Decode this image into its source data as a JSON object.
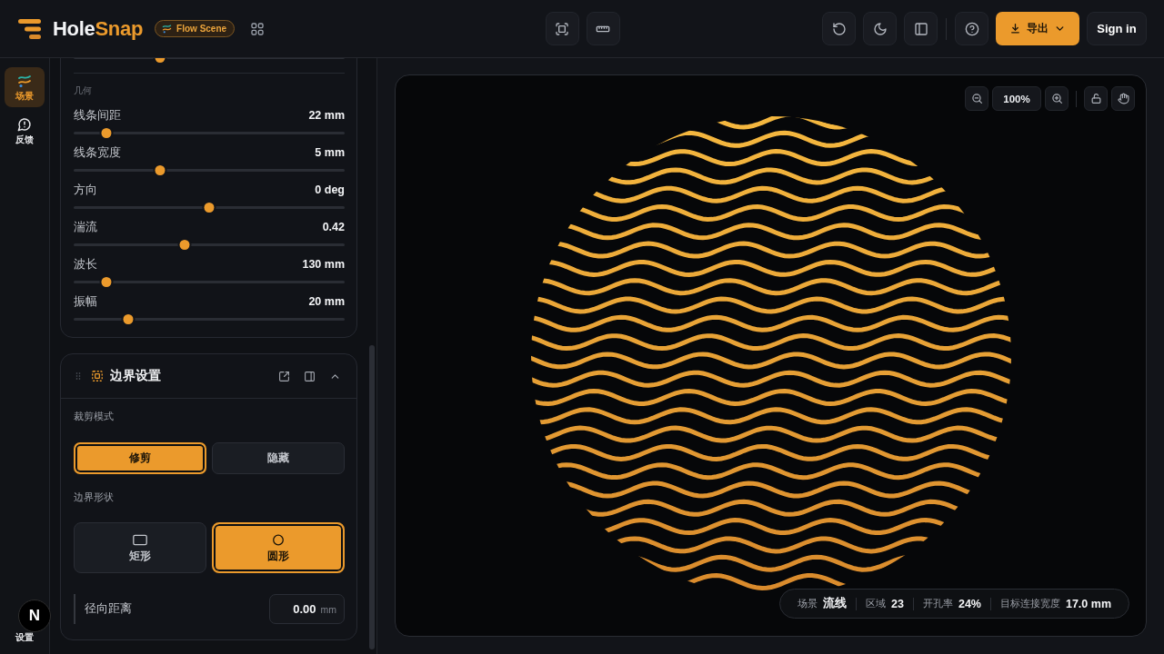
{
  "header": {
    "logo": {
      "main": "Hole",
      "accent": "Snap"
    },
    "badge": "Flow Scene",
    "export_button": "导出",
    "sign_in_button": "Sign in"
  },
  "rail": {
    "items": [
      {
        "label": "场景",
        "kind": "scene",
        "selected": true
      },
      {
        "label": "反馈",
        "kind": "feedback",
        "selected": false
      }
    ],
    "bottom_label": "设置"
  },
  "dev_badge": "N",
  "panel": {
    "top_slider": {
      "level": 0.32
    },
    "geometry": {
      "heading": "几何",
      "sliders": [
        {
          "label": "线条间距",
          "value": "22 mm",
          "level": 0.12
        },
        {
          "label": "线条宽度",
          "value": "5 mm",
          "level": 0.32
        },
        {
          "label": "方向",
          "value": "0 deg",
          "level": 0.5
        },
        {
          "label": "湍流",
          "value": "0.42",
          "level": 0.41
        },
        {
          "label": "波长",
          "value": "130 mm",
          "level": 0.12
        },
        {
          "label": "振幅",
          "value": "20 mm",
          "level": 0.2
        }
      ]
    },
    "boundary": {
      "title": "边界设置",
      "expanded": true,
      "clip_mode": {
        "label": "裁剪模式",
        "options": [
          {
            "label": "修剪",
            "selected": true
          },
          {
            "label": "隐藏",
            "selected": false
          }
        ]
      },
      "shape": {
        "label": "边界形状",
        "options": [
          {
            "label": "矩形",
            "kind": "rectangle",
            "selected": false
          },
          {
            "label": "圆形",
            "kind": "circle",
            "selected": true
          }
        ]
      },
      "radial_distance": {
        "label": "径向距离",
        "value": "0.00",
        "unit": "mm"
      }
    }
  },
  "canvas": {
    "zoom": "100%",
    "locked": false,
    "status": [
      {
        "label": "场景",
        "value": "流线"
      },
      {
        "label": "区域",
        "value": "23"
      },
      {
        "label": "开孔率",
        "value": "24%"
      },
      {
        "label": "目标连接宽度",
        "value": "17.0 mm"
      }
    ]
  }
}
